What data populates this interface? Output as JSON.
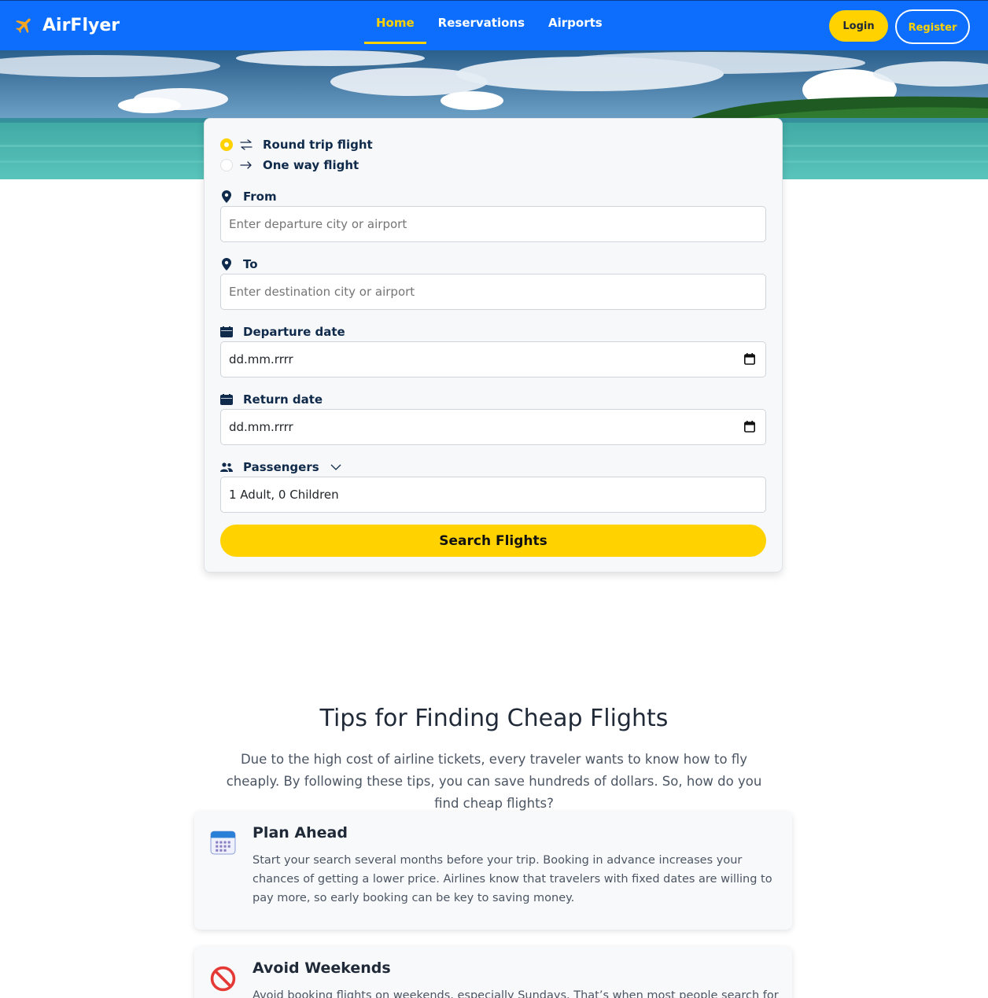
{
  "brand": {
    "name": "AirFlyer"
  },
  "nav": {
    "links": [
      {
        "label": "Home",
        "active": true
      },
      {
        "label": "Reservations",
        "active": false
      },
      {
        "label": "Airports",
        "active": false
      }
    ],
    "login_label": "Login",
    "register_label": "Register"
  },
  "search": {
    "trip_types": [
      {
        "label": "Round trip flight",
        "selected": true
      },
      {
        "label": "One way flight",
        "selected": false
      }
    ],
    "from": {
      "label": "From",
      "placeholder": "Enter departure city or airport"
    },
    "to": {
      "label": "To",
      "placeholder": "Enter destination city or airport"
    },
    "departure": {
      "label": "Departure date",
      "value": "dd.mm.rrrr"
    },
    "return": {
      "label": "Return date",
      "value": "dd.mm.rrrr"
    },
    "passengers": {
      "label": "Passengers",
      "value": "1 Adult, 0 Children"
    },
    "button_label": "Search Flights"
  },
  "tips": {
    "title": "Tips for Finding Cheap Flights",
    "intro": "Due to the high cost of airline tickets, every traveler wants to know how to fly cheaply. By following these tips, you can save hundreds of dollars. So, how do you find cheap flights?",
    "items": [
      {
        "title": "Plan Ahead",
        "icon": "calendar-icon",
        "text": "Start your search several months before your trip. Booking in advance increases your chances of getting a lower price. Airlines know that travelers with fixed dates are willing to pay more, so early booking can be key to saving money."
      },
      {
        "title": "Avoid Weekends",
        "icon": "prohibited-icon",
        "text": "Avoid booking flights on weekends, especially Sundays. That’s when most people search for"
      }
    ]
  },
  "colors": {
    "primary": "#0d6efd",
    "accent": "#ffd200",
    "navy": "#0f2a4a"
  }
}
